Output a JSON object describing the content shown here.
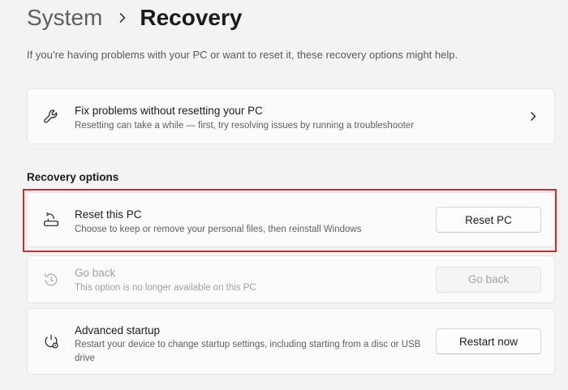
{
  "breadcrumb": {
    "parent": "System",
    "current": "Recovery"
  },
  "intro": "If you’re having problems with your PC or want to reset it, these recovery options might help.",
  "fix_card": {
    "title": "Fix problems without resetting your PC",
    "description": "Resetting can take a while — first, try resolving issues by running a troubleshooter",
    "icon": "wrench-icon"
  },
  "section": {
    "label": "Recovery options"
  },
  "reset_card": {
    "title": "Reset this PC",
    "description": "Choose to keep or remove your personal files, then reinstall Windows",
    "button_label": "Reset PC",
    "icon": "reset-pc-icon"
  },
  "goback_card": {
    "title": "Go back",
    "description": "This option is no longer available on this PC",
    "button_label": "Go back",
    "disabled": true,
    "icon": "history-icon"
  },
  "advanced_card": {
    "title": "Advanced startup",
    "description": "Restart your device to change startup settings, including starting from a disc or USB drive",
    "button_label": "Restart now",
    "icon": "power-gear-icon"
  },
  "colors": {
    "highlight": "#d9242a",
    "background": "#f3f3f3",
    "card": "#fbfbfb"
  }
}
